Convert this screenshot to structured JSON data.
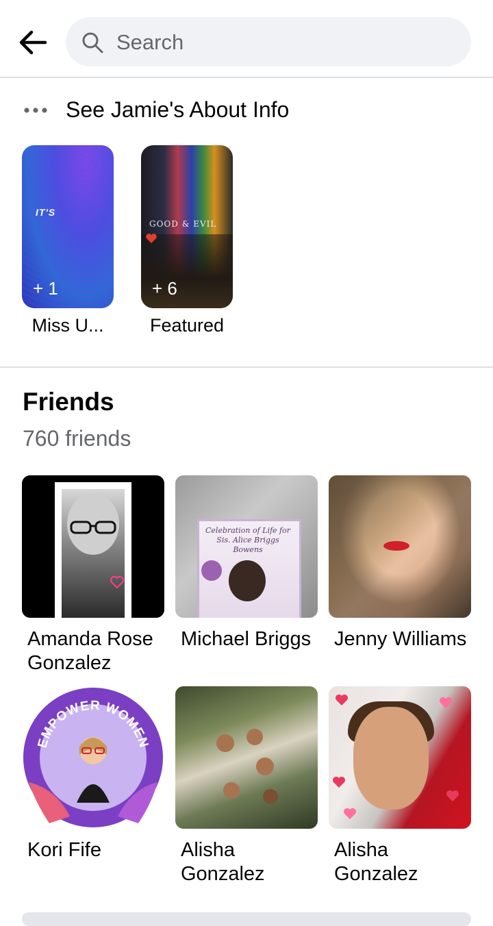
{
  "search": {
    "placeholder": "Search"
  },
  "about": {
    "label": "See Jamie's About Info"
  },
  "highlights": [
    {
      "name": "Miss U...",
      "count": "+ 1",
      "overlay_text": "IT'S"
    },
    {
      "name": "Featured",
      "count": "+ 6",
      "overlay_text": "GOOD & EVIL"
    }
  ],
  "friends": {
    "title": "Friends",
    "count": "760 friends",
    "items": [
      {
        "name": "Amanda Rose Gonzalez"
      },
      {
        "name": "Michael Briggs",
        "photo_text": "Celebration of Life for Sis. Alice Briggs Bowens"
      },
      {
        "name": "Jenny Williams"
      },
      {
        "name": "Kori Fife",
        "photo_text": "EMPOWER WOMEN"
      },
      {
        "name": "Alisha Gonzalez"
      },
      {
        "name": "Alisha Gonzalez"
      }
    ]
  },
  "colors": {
    "bar_bg": "#f0f2f5",
    "secondary_text": "#65676b",
    "divider": "#dcdfe3"
  },
  "icons": {
    "back": "back-arrow-icon",
    "search": "search-icon",
    "more": "more-dots-icon"
  }
}
